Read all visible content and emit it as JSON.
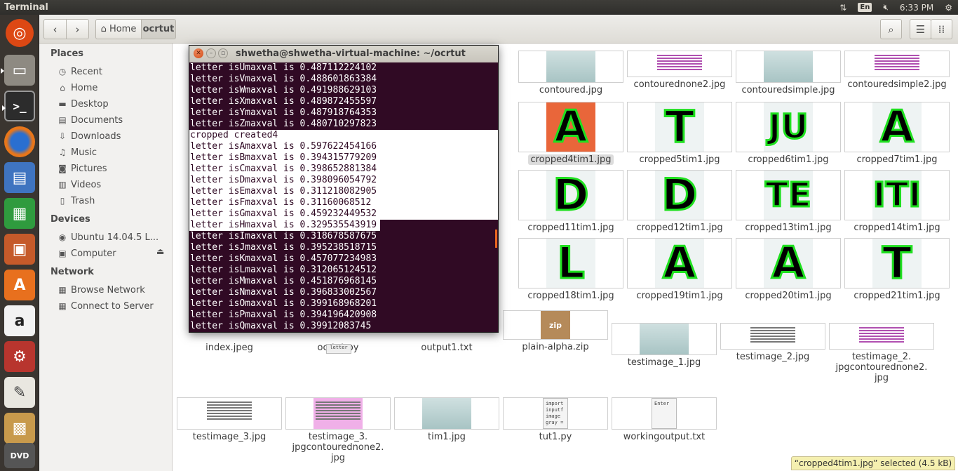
{
  "top_panel": {
    "app_title": "Terminal",
    "keyboard_layout": "En",
    "clock": "6:33 PM",
    "icons": [
      "network-arrows-icon",
      "volume-muted-icon",
      "settings-gear-icon"
    ]
  },
  "launcher": {
    "items": [
      "dash-home-icon",
      "files-icon",
      "terminal-icon",
      "firefox-icon",
      "libreoffice-writer-icon",
      "libreoffice-calc-icon",
      "libreoffice-impress-icon",
      "software-center-icon",
      "amazon-icon",
      "system-settings-icon",
      "text-editor-icon",
      "image-viewer-icon",
      "dvd-icon"
    ]
  },
  "files": {
    "breadcrumb": {
      "home": "Home",
      "current": "ocrtut"
    },
    "sidebar": {
      "places_header": "Places",
      "places": [
        {
          "label": "Recent",
          "icon": "clock-icon"
        },
        {
          "label": "Home",
          "icon": "home-icon"
        },
        {
          "label": "Desktop",
          "icon": "folder-icon"
        },
        {
          "label": "Documents",
          "icon": "document-icon"
        },
        {
          "label": "Downloads",
          "icon": "download-icon"
        },
        {
          "label": "Music",
          "icon": "music-icon"
        },
        {
          "label": "Pictures",
          "icon": "camera-icon"
        },
        {
          "label": "Videos",
          "icon": "film-icon"
        },
        {
          "label": "Trash",
          "icon": "trash-icon"
        }
      ],
      "devices_header": "Devices",
      "devices": [
        {
          "label": "Ubuntu 14.04.5 L...",
          "icon": "disc-icon"
        },
        {
          "label": "Computer",
          "icon": "computer-icon"
        }
      ],
      "network_header": "Network",
      "network": [
        {
          "label": "Browse Network",
          "icon": "network-icon"
        },
        {
          "label": "Connect to Server",
          "icon": "server-icon"
        }
      ]
    },
    "grid": {
      "row1": [
        "contoured.jpg",
        "contourednone2.jpg",
        "contouredsimple.jpg",
        "contouredsimple2.jpg"
      ],
      "row2": [
        "cropped4tim1.jpg",
        "cropped5tim1.jpg",
        "cropped6tim1.jpg",
        "cropped7tim1.jpg"
      ],
      "row2_glyphs": [
        "A",
        "T",
        "JU",
        "A"
      ],
      "row3": [
        "cropped11tim1.jpg",
        "cropped12tim1.jpg",
        "cropped13tim1.jpg",
        "cropped14tim1.jpg"
      ],
      "row3_glyphs": [
        "D",
        "D",
        "TE",
        "ITI"
      ],
      "row4": [
        "cropped18tim1.jpg",
        "cropped19tim1.jpg",
        "cropped20tim1.jpg",
        "cropped21tim1.jpg"
      ],
      "row4_glyphs": [
        "L",
        "A",
        "A",
        "T"
      ],
      "row5": [
        "index.jpeg",
        "ocrtut.py",
        "output1.txt",
        "plain-alpha.zip",
        "testimage_1.jpg",
        "testimage_2.jpg",
        "testimage_2.\njpgcontourednone2.\njpg"
      ],
      "row6": [
        "testimage_3.jpg",
        "testimage_3.\njpgcontourednone2.\njpg",
        "tim1.jpg",
        "tut1.py",
        "workingoutput.txt"
      ],
      "zip_badge": "zip",
      "tut1_preview": "import\ninputf\nimage\ngray =",
      "workingoutput_preview": "Enter",
      "ocrtut_preview": "letter"
    },
    "status": "“cropped4tim1.jpg” selected  (4.5 kB)"
  },
  "terminal": {
    "title": "shwetha@shwetha-virtual-machine: ~/ocrtut",
    "lines": [
      "letter isUmaxval is 0.487112224102",
      "letter isVmaxval is 0.488601863384",
      "letter isWmaxval is 0.491988629103",
      "letter isXmaxval is 0.489872455597",
      "letter isYmaxval is 0.487918764353",
      "letter isZmaxval is 0.480710297823",
      "cropped created4",
      "letter isAmaxval is 0.597622454166",
      "letter isBmaxval is 0.394315779209",
      "letter isCmaxval is 0.398652881384",
      "letter isDmaxval is 0.398096054792",
      "letter isEmaxval is 0.311218082905",
      "letter isFmaxval is 0.31160068512",
      "letter isGmaxval is 0.459232449532",
      "letter isHmaxval is 0.329535543919",
      "letter isImaxval is 0.318678587675",
      "letter isJmaxval is 0.395238518715",
      "letter isKmaxval is 0.457077234983",
      "letter isLmaxval is 0.312065124512",
      "letter isMmaxval is 0.451876968145",
      "letter isNmaxval is 0.396833002567",
      "letter isOmaxval is 0.399168968201",
      "letter isPmaxval is 0.394196420908",
      "letter isQmaxval is 0.39912083745"
    ],
    "selected_range": [
      6,
      13
    ],
    "partial_selected_line": 14
  },
  "colors": {
    "terminal_bg": "#300a24",
    "letter_stroke": "#1fe01f",
    "selected_thumb_bg": "#e9663a",
    "launcher_bg": "#3a3530"
  }
}
